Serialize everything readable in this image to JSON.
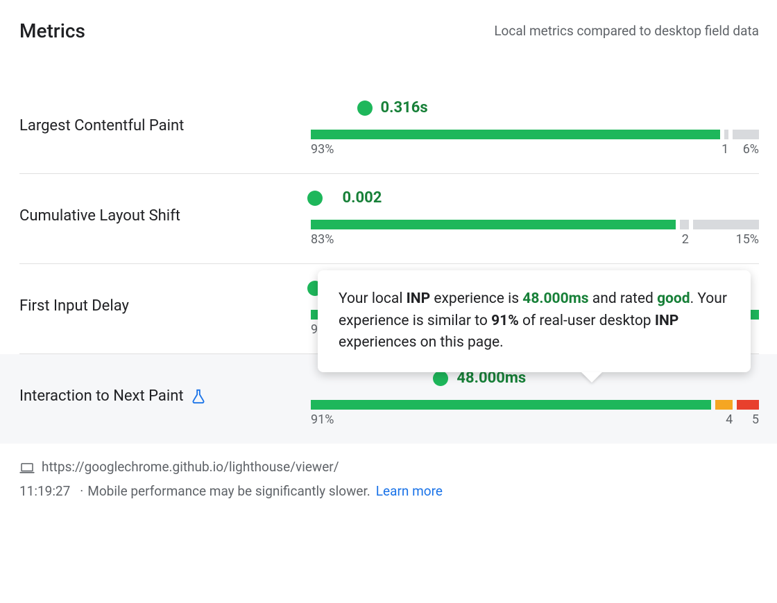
{
  "header": {
    "title": "Metrics",
    "subtitle": "Local metrics compared to desktop field data"
  },
  "metrics": [
    {
      "name": "Largest Contentful Paint",
      "value": "0.316s",
      "marker_pct": 12,
      "segments": [
        {
          "pct": 93,
          "class": "good",
          "label": "93%",
          "align": "l"
        },
        {
          "pct": 1,
          "class": "grey",
          "label": "1",
          "align": "r"
        },
        {
          "pct": 6,
          "class": "grey",
          "label": "6%",
          "align": "r"
        }
      ]
    },
    {
      "name": "Cumulative Layout Shift",
      "value": "0.002",
      "marker_pct": 1,
      "segments": [
        {
          "pct": 83,
          "class": "good",
          "label": "83%",
          "align": "l"
        },
        {
          "pct": 2,
          "class": "grey",
          "label": "2",
          "align": "r"
        },
        {
          "pct": 15,
          "class": "grey",
          "label": "15%",
          "align": "r"
        }
      ]
    },
    {
      "name": "First Input Delay",
      "value": "",
      "marker_pct": 1,
      "hidden_by_tooltip": true,
      "segments": [
        {
          "pct": 9,
          "class": "good",
          "label": "9",
          "align": "l"
        }
      ]
    },
    {
      "name": "Interaction to Next Paint",
      "value": "48.000ms",
      "experimental": true,
      "highlight": true,
      "marker_pct": 29,
      "segments": [
        {
          "pct": 91,
          "class": "good",
          "label": "91%",
          "align": "l"
        },
        {
          "pct": 4,
          "class": "warn",
          "label": "4",
          "align": "r"
        },
        {
          "pct": 5,
          "class": "poor",
          "label": "5",
          "align": "r"
        }
      ]
    }
  ],
  "tooltip": {
    "t1": "Your local ",
    "t2": "INP",
    "t3": " experience is ",
    "t4": "48.000ms",
    "t5": " and rated ",
    "t6": "good",
    "t7": ". Your experience is similar to ",
    "t8": "91%",
    "t9": " of real-user desktop ",
    "t10": "INP",
    "t11": " experiences on this page."
  },
  "footer": {
    "url": "https://googlechrome.github.io/lighthouse/viewer/",
    "time": "11:19:27",
    "note": "Mobile performance may be significantly slower.",
    "link": "Learn more"
  },
  "chart_data": {
    "type": "bar",
    "title": "Local metrics vs desktop field data distribution",
    "series": [
      {
        "name": "Largest Contentful Paint",
        "local_value": "0.316s",
        "distribution": {
          "good": 93,
          "needs_work": 1,
          "poor": 6
        }
      },
      {
        "name": "Cumulative Layout Shift",
        "local_value": "0.002",
        "distribution": {
          "good": 83,
          "needs_work": 2,
          "poor": 15
        }
      },
      {
        "name": "First Input Delay",
        "local_value": null,
        "distribution": null
      },
      {
        "name": "Interaction to Next Paint",
        "local_value": "48.000ms",
        "distribution": {
          "good": 91,
          "needs_work": 4,
          "poor": 5
        }
      }
    ]
  }
}
